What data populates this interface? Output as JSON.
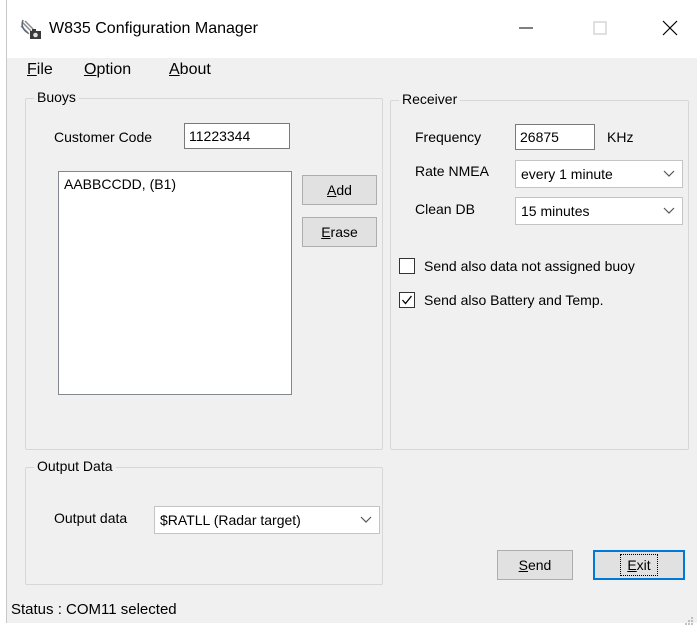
{
  "window": {
    "title": "W835 Configuration Manager",
    "icon": "satellite-antenna-icon"
  },
  "menu": {
    "file": {
      "hotkey": "F",
      "rest": "ile"
    },
    "option": {
      "hotkey": "O",
      "rest": "ption"
    },
    "about": {
      "hotkey": "A",
      "rest": "bout"
    }
  },
  "buoys": {
    "title": "Buoys",
    "customer_code_label": "Customer Code",
    "customer_code_value": "11223344",
    "list_items": [
      "AABBCCDD, (B1)"
    ],
    "add": {
      "hotkey": "A",
      "rest": "dd"
    },
    "erase": {
      "hotkey": "E",
      "rest": "rase"
    }
  },
  "receiver": {
    "title": "Receiver",
    "frequency_label": "Frequency",
    "frequency_value": "26875",
    "frequency_unit": "KHz",
    "rate_nmea_label": "Rate NMEA",
    "rate_nmea_value": "every 1 minute",
    "clean_db_label": "Clean DB",
    "clean_db_value": "15 minutes",
    "send_unassigned_label": "Send also data not assigned buoy",
    "send_unassigned_checked": false,
    "send_battery_label": "Send also Battery and Temp.",
    "send_battery_checked": true
  },
  "output": {
    "title": "Output Data",
    "label": "Output data",
    "value": "$RATLL (Radar target)"
  },
  "buttons": {
    "send": {
      "hotkey": "S",
      "rest": "end"
    },
    "exit": {
      "hotkey": "E",
      "rest": "xit"
    }
  },
  "status": {
    "text": "Status : COM11 selected"
  }
}
